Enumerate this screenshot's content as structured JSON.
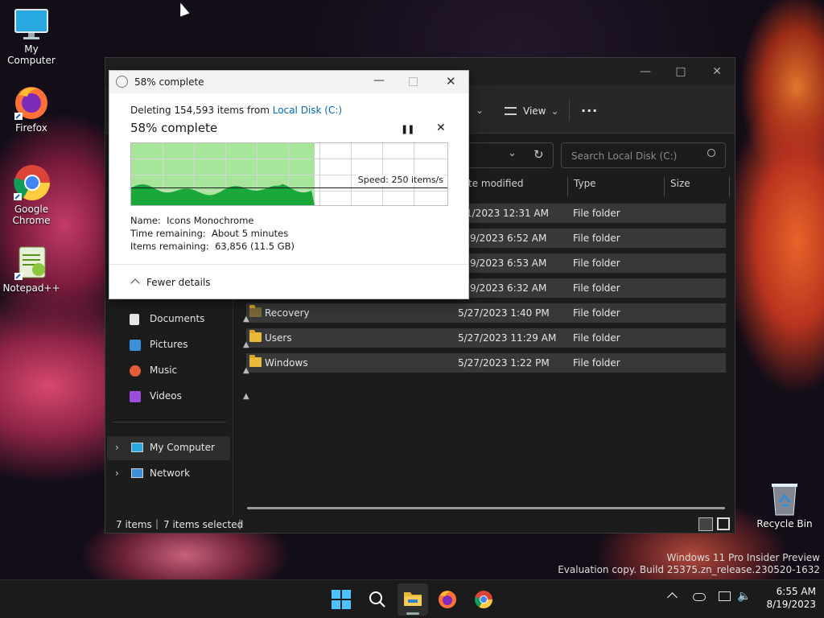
{
  "desktop": {
    "icons": [
      {
        "label": "My Computer"
      },
      {
        "label": "Firefox"
      },
      {
        "label": "Google Chrome"
      },
      {
        "label": "Notepad++"
      },
      {
        "label": "Recycle Bin"
      }
    ],
    "watermark": {
      "line1": "Windows 11 Pro Insider Preview",
      "line2": "Evaluation copy. Build 25375.zn_release.230520-1632"
    }
  },
  "explorer": {
    "toolbar": {
      "view_label": "View",
      "more_label": "···"
    },
    "search_placeholder": "Search Local Disk (C:)",
    "columns": [
      "te modified",
      "Type",
      "Size"
    ],
    "rows": [
      {
        "name": "",
        "date": "1/2023 12:31 AM",
        "type": "File folder"
      },
      {
        "name": "",
        "date": "9/2023 6:52 AM",
        "type": "File folder"
      },
      {
        "name": "",
        "date": "9/2023 6:53 AM",
        "type": "File folder"
      },
      {
        "name": "",
        "date": "9/2023 6:32 AM",
        "type": "File folder"
      },
      {
        "name": "Recovery",
        "date": "5/27/2023 1:40 PM",
        "type": "File folder"
      },
      {
        "name": "Users",
        "date": "5/27/2023 11:29 AM",
        "type": "File folder"
      },
      {
        "name": "Windows",
        "date": "5/27/2023 1:22 PM",
        "type": "File folder"
      }
    ],
    "nav": [
      {
        "label": "Documents"
      },
      {
        "label": "Pictures"
      },
      {
        "label": "Music"
      },
      {
        "label": "Videos"
      },
      {
        "label": "My Computer"
      },
      {
        "label": "Network"
      }
    ],
    "status": {
      "items": "7 items",
      "selected": "7 items selected"
    }
  },
  "dialog": {
    "title": "58% complete",
    "deleting_prefix": "Deleting 154,593 items from ",
    "deleting_link": "Local Disk (C:)",
    "heading": "58% complete",
    "progress": 0.58,
    "speed": "Speed: 250 items/s",
    "name_line": "Name:  Icons Monochrome",
    "time_line": "Time remaining:  About 5 minutes",
    "items_line": "Items remaining:  63,856 (11.5 GB)",
    "fewer_details": "Fewer details"
  },
  "taskbar": {
    "time": "6:55 AM",
    "date": "8/19/2023"
  },
  "colors": {
    "accent": "#0067c0",
    "progress_fill": "#a6e59a",
    "progress_wave": "#1aa83a",
    "taskbar": "#1b1b1b"
  }
}
